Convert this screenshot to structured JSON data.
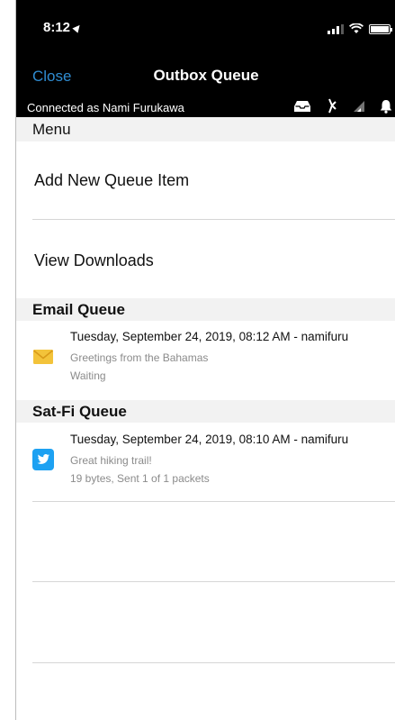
{
  "status_bar": {
    "time": "8:12"
  },
  "nav": {
    "close_label": "Close",
    "title": "Outbox Queue"
  },
  "connection": {
    "text": "Connected as Nami Furukawa"
  },
  "menu": {
    "header": "Menu",
    "items": [
      {
        "label": "Add New Queue Item"
      },
      {
        "label": "View Downloads"
      }
    ]
  },
  "email_queue": {
    "header": "Email Queue",
    "items": [
      {
        "title": "Tuesday, September 24, 2019, 08:12 AM - namifuru",
        "subtitle": "Greetings from the Bahamas",
        "status": "Waiting",
        "icon": "envelope-icon"
      }
    ]
  },
  "satfi_queue": {
    "header": "Sat-Fi Queue",
    "items": [
      {
        "title": "Tuesday, September 24, 2019, 08:10 AM - namifuru",
        "subtitle": "Great hiking trail!",
        "status": "19 bytes, Sent 1 of 1 packets",
        "icon": "twitter-icon"
      }
    ]
  },
  "colors": {
    "accent": "#2f8cd1",
    "header_bg": "#000000",
    "section_bg": "#f2f2f2",
    "envelope": "#f3c33a",
    "twitter": "#1da1f2"
  }
}
